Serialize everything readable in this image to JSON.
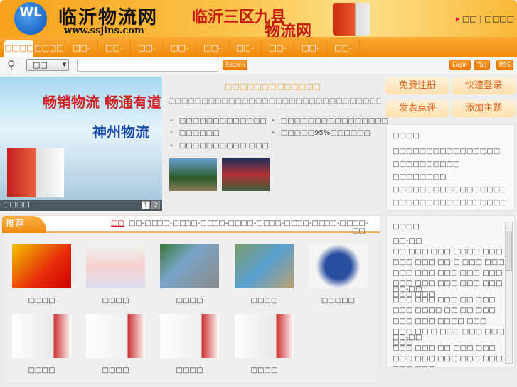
{
  "header": {
    "logo_mark": "WL",
    "logo_title": "临沂物流网",
    "logo_url": "www.ssjins.com",
    "slogan_line1": "临沂三区九县",
    "slogan_line2": "物流网",
    "links": [
      "□□",
      "□□□□"
    ],
    "separator": "|"
  },
  "nav": {
    "tabs": [
      "□□□□",
      "□□□□",
      "□□-□□",
      "□□-□□",
      "□□-□□",
      "□□-□□",
      "□□-□□",
      "□□-□□",
      "□□-□□",
      "□□-□□",
      "□□-□□"
    ]
  },
  "search": {
    "category": "□□",
    "value": "",
    "button": "Search",
    "login": "Login",
    "tag": "Tag",
    "rss": "RSS"
  },
  "banner": {
    "line1": "畅销物流 畅通有道",
    "line2": "神州物流",
    "caption": "□□□□",
    "pages": [
      "1",
      "2"
    ]
  },
  "center": {
    "title": "□□□□□□□□□□□□□",
    "desc": "□□□□□□□□□□□□□□□□□□□□□□□□□□□□□□□□□□□□□□□□□□□□□□□□···",
    "items": [
      "□□□□□□□□□□□□□",
      "□□□□□□□□□□□□□□□□",
      "□□□□□□",
      "□□□□□95%□□□□□□",
      "□□□□□□□□□□ □□□"
    ]
  },
  "actions": {
    "register": "免费注册",
    "login": "快速登录",
    "review": "发表点评",
    "topic": "添加主题"
  },
  "notice": {
    "title": "□□□□",
    "items": [
      "□□□□□□□□□□□□□□□□",
      "□□□□□□□□□□",
      "□□□□□□□□",
      "□□□□□□□□□□□□□□□□□",
      "□□□□□□□□□□□□□□□□□"
    ]
  },
  "friends": {
    "title": "□□□□",
    "groups": [
      {
        "name": "□□-□□",
        "text": "□□ □□□ □□□ □□□□ □□□ □□□ □□□ □□ □ □□□ □□□ □□□ □□□ □□□ □□□ □□□ □□□ □□□ □□□ □□□ □□□ □□□ □□□"
      },
      {
        "name": "□□-□□",
        "text": "□□□ □□□ □□□ □□ □□□ □□□ □□□□ □□ □□ □□□ □□□ □□□ □□□□ □□□ □□□ □□ □ □□□ □□□ □□□ □□□"
      },
      {
        "name": "□□-□□",
        "text": "□□□ □□□ □□ □□□ □□□ □□□ □□□ □□□ □□□ □□□ □□□ □□□"
      }
    ]
  },
  "recommend": {
    "title": "推荐",
    "tabs": [
      "□□",
      "□□-□□",
      "□□-□□",
      "□□-□□",
      "□□-□□",
      "□□-□□",
      "□□-□□",
      "□□-□□",
      "□□-□□",
      "□□-□□"
    ],
    "items": [
      "□□□□",
      "□□□□",
      "□□□□",
      "□□□□",
      "□□□□□",
      "□□□□",
      "□□□□",
      "□□□□",
      "□□□□"
    ]
  }
}
